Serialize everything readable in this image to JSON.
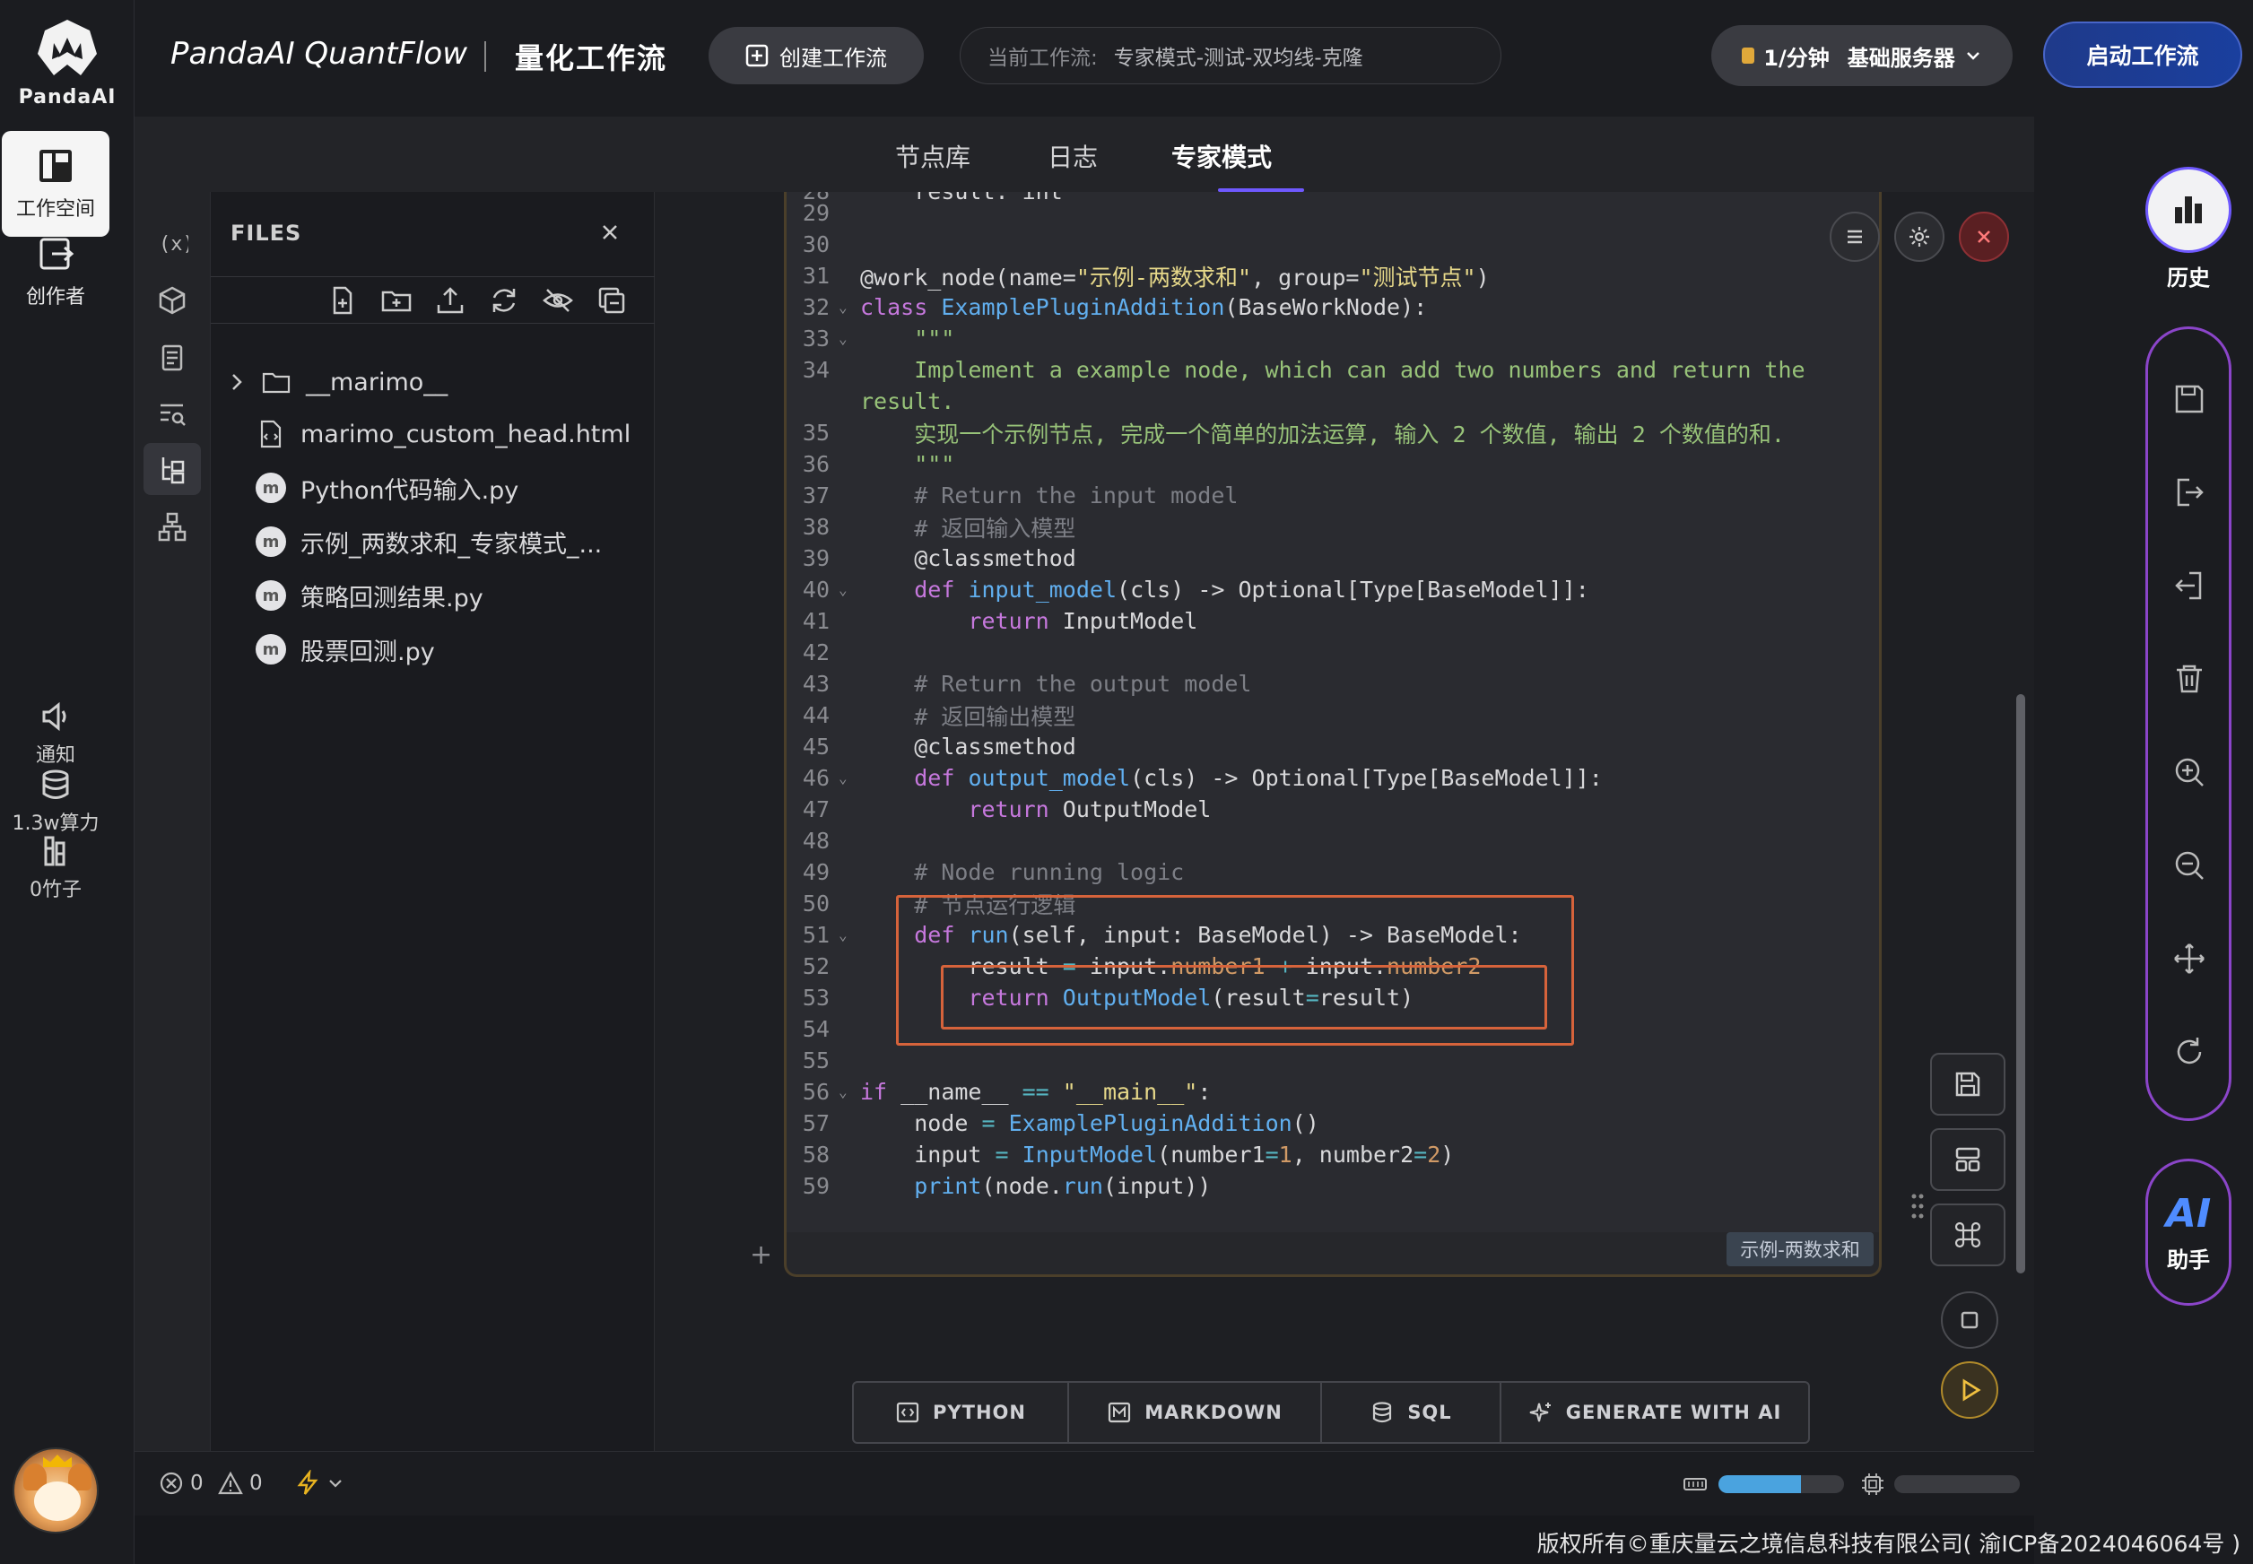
{
  "app": {
    "logo_text": "PandaAI",
    "brand": "PandaAI QuantFlow",
    "brand_sub": "量化工作流"
  },
  "left_rail": {
    "workspace": "工作空间",
    "creator": "创作者",
    "notify": "通知",
    "compute": "1.3w算力",
    "bamboo": "0竹子"
  },
  "topbar": {
    "create_label": "创建工作流",
    "current_label": "当前工作流:",
    "current_value": "专家模式-测试-双均线-克隆",
    "server_rate": "1/分钟",
    "server_name": "基础服务器",
    "start_label": "启动工作流"
  },
  "tabs": [
    "节点库",
    "日志",
    "专家模式"
  ],
  "files": {
    "title": "FILES",
    "items": [
      "__marimo__",
      "marimo_custom_head.html",
      "Python代码输入.py",
      "示例_两数求和_专家模式_...",
      "策略回测结果.py",
      "股票回测.py"
    ]
  },
  "editor": {
    "cell_label": "示例-两数求和",
    "lines": {
      "l28": "    result: int",
      "l31_name": "示例-两数求和",
      "l31_group": "测试节点",
      "l34": "    Implement a example node, which can add two numbers and return the",
      "l34b": "result.",
      "l35": "    实现一个示例节点, 完成一个简单的加法运算, 输入 2 个数值, 输出 2 个数值的和.",
      "l37": "    # Return the input model",
      "l38": "    # 返回输入模型",
      "l43": "    # Return the output model",
      "l44": "    # 返回输出模型",
      "l49": "    # Node running logic",
      "l50": "    # 节点运行逻辑"
    }
  },
  "cell_toolbar": {
    "python": "PYTHON",
    "markdown": "MARKDOWN",
    "sql": "SQL",
    "ai": "GENERATE WITH AI"
  },
  "right_rail": {
    "history": "历史",
    "ai_text": "AI",
    "ai_label": "助手"
  },
  "statusbar": {
    "errors": "0",
    "warnings": "0",
    "memory_fill": 0.66
  },
  "footer": {
    "copyright": "版权所有©重庆量云之境信息科技有限公司( 渝ICP备2024046064号 )"
  },
  "colors": {
    "accent": "#6f59ff",
    "highlight_box": "#d6633b",
    "start_button": "#1f3a8a"
  }
}
